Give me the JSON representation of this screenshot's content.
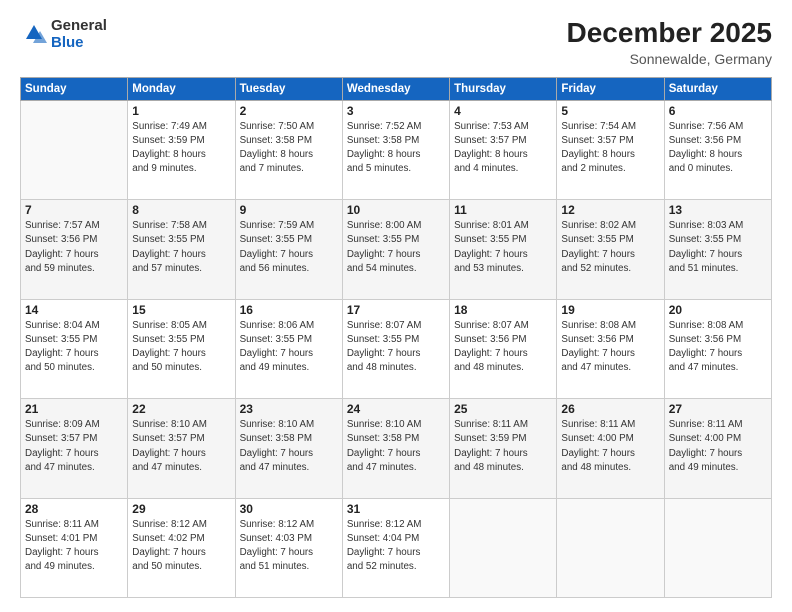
{
  "header": {
    "logo_general": "General",
    "logo_blue": "Blue",
    "title": "December 2025",
    "location": "Sonnewalde, Germany"
  },
  "days_of_week": [
    "Sunday",
    "Monday",
    "Tuesday",
    "Wednesday",
    "Thursday",
    "Friday",
    "Saturday"
  ],
  "weeks": [
    [
      {
        "day": "",
        "info": ""
      },
      {
        "day": "1",
        "info": "Sunrise: 7:49 AM\nSunset: 3:59 PM\nDaylight: 8 hours\nand 9 minutes."
      },
      {
        "day": "2",
        "info": "Sunrise: 7:50 AM\nSunset: 3:58 PM\nDaylight: 8 hours\nand 7 minutes."
      },
      {
        "day": "3",
        "info": "Sunrise: 7:52 AM\nSunset: 3:58 PM\nDaylight: 8 hours\nand 5 minutes."
      },
      {
        "day": "4",
        "info": "Sunrise: 7:53 AM\nSunset: 3:57 PM\nDaylight: 8 hours\nand 4 minutes."
      },
      {
        "day": "5",
        "info": "Sunrise: 7:54 AM\nSunset: 3:57 PM\nDaylight: 8 hours\nand 2 minutes."
      },
      {
        "day": "6",
        "info": "Sunrise: 7:56 AM\nSunset: 3:56 PM\nDaylight: 8 hours\nand 0 minutes."
      }
    ],
    [
      {
        "day": "7",
        "info": "Sunrise: 7:57 AM\nSunset: 3:56 PM\nDaylight: 7 hours\nand 59 minutes."
      },
      {
        "day": "8",
        "info": "Sunrise: 7:58 AM\nSunset: 3:55 PM\nDaylight: 7 hours\nand 57 minutes."
      },
      {
        "day": "9",
        "info": "Sunrise: 7:59 AM\nSunset: 3:55 PM\nDaylight: 7 hours\nand 56 minutes."
      },
      {
        "day": "10",
        "info": "Sunrise: 8:00 AM\nSunset: 3:55 PM\nDaylight: 7 hours\nand 54 minutes."
      },
      {
        "day": "11",
        "info": "Sunrise: 8:01 AM\nSunset: 3:55 PM\nDaylight: 7 hours\nand 53 minutes."
      },
      {
        "day": "12",
        "info": "Sunrise: 8:02 AM\nSunset: 3:55 PM\nDaylight: 7 hours\nand 52 minutes."
      },
      {
        "day": "13",
        "info": "Sunrise: 8:03 AM\nSunset: 3:55 PM\nDaylight: 7 hours\nand 51 minutes."
      }
    ],
    [
      {
        "day": "14",
        "info": "Sunrise: 8:04 AM\nSunset: 3:55 PM\nDaylight: 7 hours\nand 50 minutes."
      },
      {
        "day": "15",
        "info": "Sunrise: 8:05 AM\nSunset: 3:55 PM\nDaylight: 7 hours\nand 50 minutes."
      },
      {
        "day": "16",
        "info": "Sunrise: 8:06 AM\nSunset: 3:55 PM\nDaylight: 7 hours\nand 49 minutes."
      },
      {
        "day": "17",
        "info": "Sunrise: 8:07 AM\nSunset: 3:55 PM\nDaylight: 7 hours\nand 48 minutes."
      },
      {
        "day": "18",
        "info": "Sunrise: 8:07 AM\nSunset: 3:56 PM\nDaylight: 7 hours\nand 48 minutes."
      },
      {
        "day": "19",
        "info": "Sunrise: 8:08 AM\nSunset: 3:56 PM\nDaylight: 7 hours\nand 47 minutes."
      },
      {
        "day": "20",
        "info": "Sunrise: 8:08 AM\nSunset: 3:56 PM\nDaylight: 7 hours\nand 47 minutes."
      }
    ],
    [
      {
        "day": "21",
        "info": "Sunrise: 8:09 AM\nSunset: 3:57 PM\nDaylight: 7 hours\nand 47 minutes."
      },
      {
        "day": "22",
        "info": "Sunrise: 8:10 AM\nSunset: 3:57 PM\nDaylight: 7 hours\nand 47 minutes."
      },
      {
        "day": "23",
        "info": "Sunrise: 8:10 AM\nSunset: 3:58 PM\nDaylight: 7 hours\nand 47 minutes."
      },
      {
        "day": "24",
        "info": "Sunrise: 8:10 AM\nSunset: 3:58 PM\nDaylight: 7 hours\nand 47 minutes."
      },
      {
        "day": "25",
        "info": "Sunrise: 8:11 AM\nSunset: 3:59 PM\nDaylight: 7 hours\nand 48 minutes."
      },
      {
        "day": "26",
        "info": "Sunrise: 8:11 AM\nSunset: 4:00 PM\nDaylight: 7 hours\nand 48 minutes."
      },
      {
        "day": "27",
        "info": "Sunrise: 8:11 AM\nSunset: 4:00 PM\nDaylight: 7 hours\nand 49 minutes."
      }
    ],
    [
      {
        "day": "28",
        "info": "Sunrise: 8:11 AM\nSunset: 4:01 PM\nDaylight: 7 hours\nand 49 minutes."
      },
      {
        "day": "29",
        "info": "Sunrise: 8:12 AM\nSunset: 4:02 PM\nDaylight: 7 hours\nand 50 minutes."
      },
      {
        "day": "30",
        "info": "Sunrise: 8:12 AM\nSunset: 4:03 PM\nDaylight: 7 hours\nand 51 minutes."
      },
      {
        "day": "31",
        "info": "Sunrise: 8:12 AM\nSunset: 4:04 PM\nDaylight: 7 hours\nand 52 minutes."
      },
      {
        "day": "",
        "info": ""
      },
      {
        "day": "",
        "info": ""
      },
      {
        "day": "",
        "info": ""
      }
    ]
  ]
}
